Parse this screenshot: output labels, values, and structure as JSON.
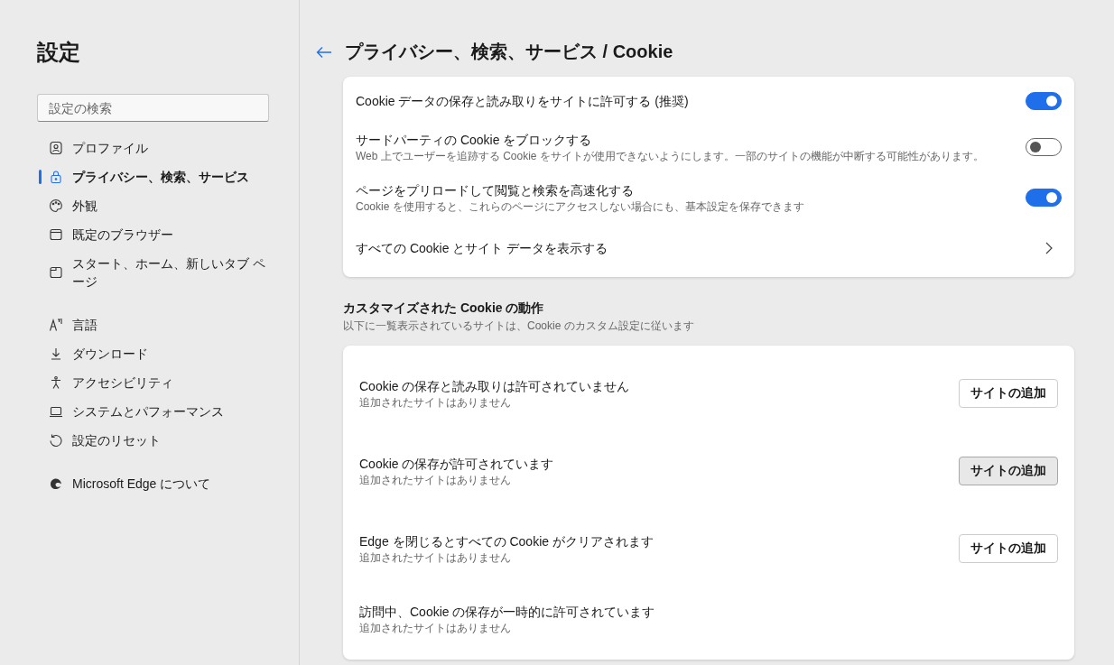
{
  "sidebar": {
    "title": "設定",
    "search": {
      "placeholder": "設定の検索"
    },
    "groups": [
      [
        {
          "label": "プロファイル",
          "selected": false
        },
        {
          "label": "プライバシー、検索、サービス",
          "selected": true
        },
        {
          "label": "外観",
          "selected": false
        },
        {
          "label": "既定のブラウザー",
          "selected": false
        },
        {
          "label": "スタート、ホーム、新しいタブ ページ",
          "selected": false
        }
      ],
      [
        {
          "label": "言語",
          "selected": false
        },
        {
          "label": "ダウンロード",
          "selected": false
        },
        {
          "label": "アクセシビリティ",
          "selected": false
        },
        {
          "label": "システムとパフォーマンス",
          "selected": false
        },
        {
          "label": "設定のリセット",
          "selected": false
        }
      ],
      [
        {
          "label": "Microsoft Edge について",
          "selected": false
        }
      ]
    ]
  },
  "header": {
    "title": "プライバシー、検索、サービス / Cookie"
  },
  "settings": [
    {
      "kind": "toggle",
      "label": "Cookie データの保存と読み取りをサイトに許可する (推奨)",
      "on": true
    },
    {
      "kind": "toggle",
      "label": "サードパーティの Cookie をブロックする",
      "description": "Web 上でユーザーを追跡する Cookie をサイトが使用できないようにします。一部のサイトの機能が中断する可能性があります。",
      "on": false
    },
    {
      "kind": "toggle",
      "label": "ページをプリロードして閲覧と検索を高速化する",
      "description": "Cookie を使用すると、これらのページにアクセスしない場合にも、基本設定を保存できます",
      "on": true
    },
    {
      "kind": "link",
      "label": "すべての Cookie とサイト データを表示する"
    }
  ],
  "custom": {
    "title": "カスタマイズされた Cookie の動作",
    "subtitle": "以下に一覧表示されているサイトは、Cookie のカスタム設定に従います",
    "rows": [
      {
        "title": "Cookie の保存と読み取りは許可されていません",
        "subtitle": "追加されたサイトはありません",
        "button": {
          "label": "サイトの追加",
          "hovered": false
        }
      },
      {
        "title": "Cookie の保存が許可されています",
        "subtitle": "追加されたサイトはありません",
        "button": {
          "label": "サイトの追加",
          "hovered": true
        }
      },
      {
        "title": "Edge を閉じるとすべての Cookie がクリアされます",
        "subtitle": "追加されたサイトはありません",
        "button": {
          "label": "サイトの追加",
          "hovered": false
        }
      },
      {
        "title": "訪問中、Cookie の保存が一時的に許可されています",
        "subtitle": "追加されたサイトはありません"
      }
    ]
  }
}
